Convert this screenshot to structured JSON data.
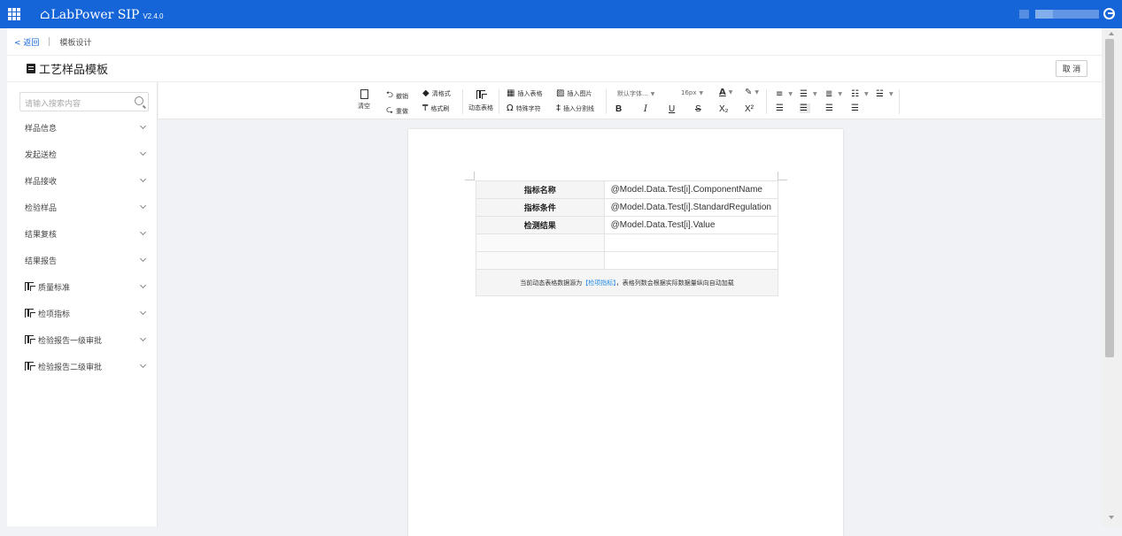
{
  "app": {
    "logo_mark": "⌂",
    "name": "LabPower SIP",
    "version": "V2.4.0"
  },
  "breadcrumb": {
    "back": "< 返回",
    "current": "模板设计"
  },
  "page": {
    "title": "工艺样品模板",
    "cancel": "取 消"
  },
  "sidebar": {
    "search_placeholder": "请输入搜索内容",
    "items": [
      {
        "label": "样品信息",
        "icon": false
      },
      {
        "label": "发起送检",
        "icon": false
      },
      {
        "label": "样品接收",
        "icon": false
      },
      {
        "label": "检验样品",
        "icon": false
      },
      {
        "label": "结果复核",
        "icon": false
      },
      {
        "label": "结果报告",
        "icon": false
      },
      {
        "label": "质量标准",
        "icon": "table-icon"
      },
      {
        "label": "检项指标",
        "icon": "table-icon"
      },
      {
        "label": "检验报告一级审批",
        "icon": "table-icon"
      },
      {
        "label": "检验报告二级审批",
        "icon": "table-icon"
      }
    ]
  },
  "toolbar": {
    "clear": "清空",
    "undo": "撤销",
    "redo": "重做",
    "clear_format": "清格式",
    "format_brush": "格式刷",
    "dynamic_table": "动态表格",
    "insert_table": "插入表格",
    "special_char": "特殊字符",
    "insert_image": "插入图片",
    "insert_divider": "插入分割线",
    "font_family": "默认字体...",
    "font_size": "16px",
    "bold": "B",
    "italic": "I",
    "underline": "U",
    "strike": "S",
    "subscript": "X₂",
    "superscript": "X²"
  },
  "template_table": {
    "rows": [
      {
        "key": "指标名称",
        "value": "@Model.Data.Test[i].ComponentName"
      },
      {
        "key": "指标条件",
        "value": "@Model.Data.Test[i].StandardRegulation"
      },
      {
        "key": "检测结果",
        "value": "@Model.Data.Test[i].Value"
      },
      {
        "key": "",
        "value": ""
      },
      {
        "key": "",
        "value": ""
      }
    ],
    "footer_prefix": "当前动态表格数据源为",
    "footer_source": "【检项指标】",
    "footer_suffix": "，表格列数会根据实际数据量纵向自动加载"
  },
  "colors": {
    "header_bg": "#1565d8",
    "accent": "#1e88e5"
  }
}
